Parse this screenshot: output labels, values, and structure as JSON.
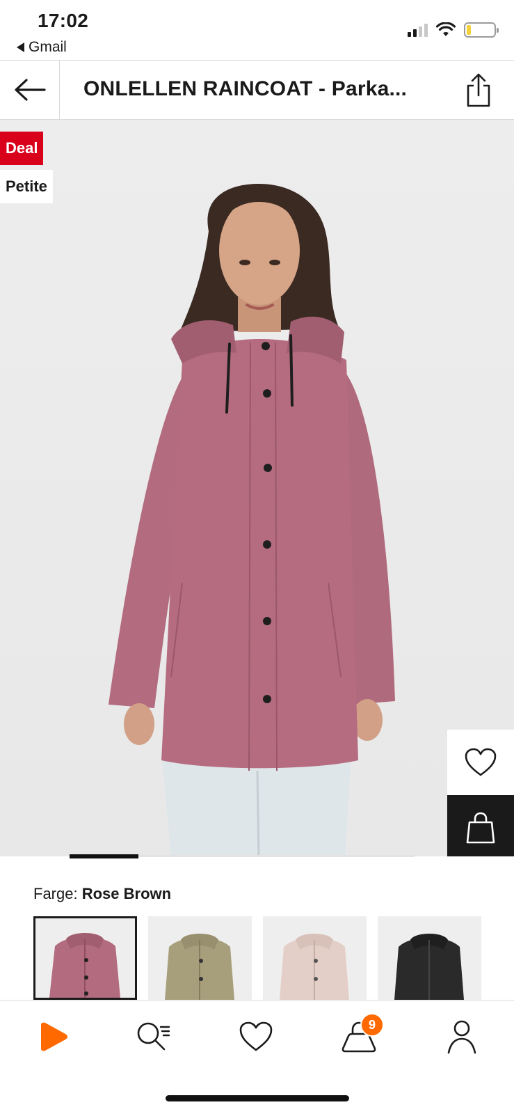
{
  "status_bar": {
    "time": "17:02",
    "back_app": "Gmail"
  },
  "header": {
    "title": "ONLELLEN RAINCOAT - Parka..."
  },
  "product": {
    "badges": [
      "Deal",
      "Petite"
    ],
    "image_alt": "Rose brown raincoat product photo",
    "carousel": {
      "current_index": 1,
      "total": 5
    }
  },
  "colour": {
    "label": "Farge:",
    "value": "Rose Brown",
    "options": [
      {
        "name": "Rose Brown",
        "selected": true,
        "color": "#b36b7f"
      },
      {
        "name": "Olive",
        "selected": false,
        "color": "#a79f7c"
      },
      {
        "name": "Pale Pink",
        "selected": false,
        "color": "#e3cfc7"
      },
      {
        "name": "Black",
        "selected": false,
        "color": "#2a2a2a"
      }
    ]
  },
  "bottom_nav": {
    "items": [
      "home",
      "search",
      "wishlist",
      "cart",
      "account"
    ],
    "cart_count": "9"
  },
  "colors": {
    "deal_badge": "#d9001b",
    "accent": "#ff6900",
    "coat": "#b36b7f"
  }
}
